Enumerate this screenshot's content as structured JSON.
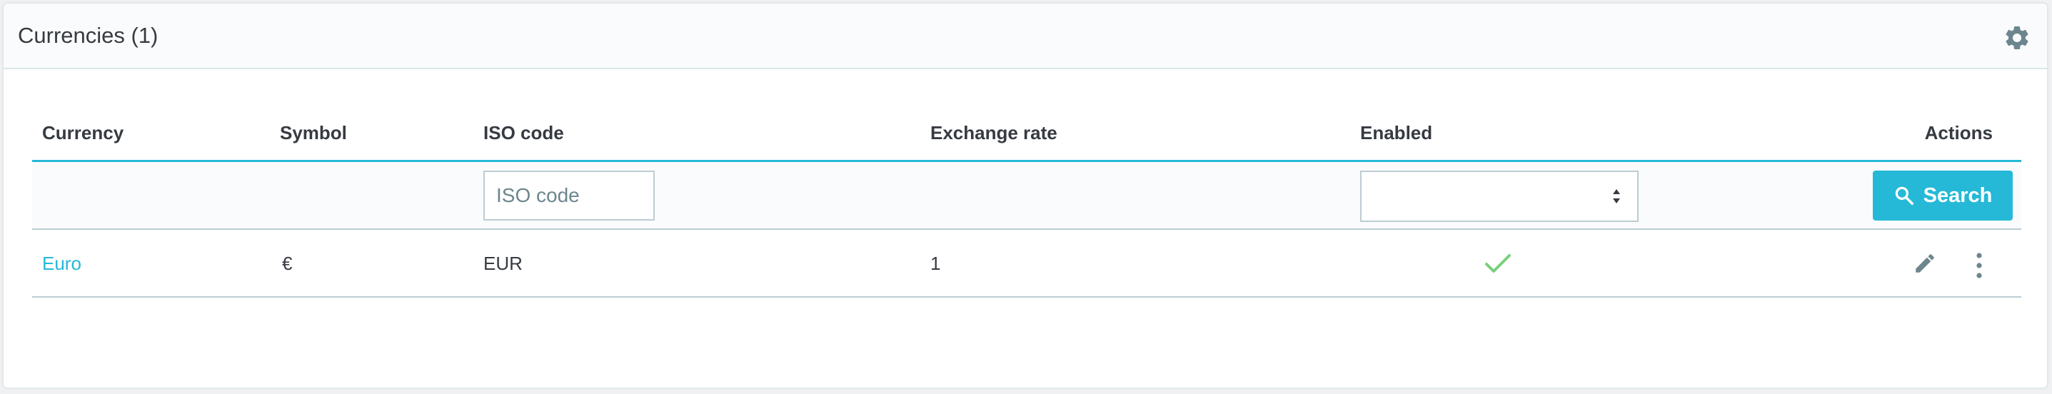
{
  "panel": {
    "title": "Currencies (1)",
    "settings_icon": "gear-icon"
  },
  "table": {
    "columns": [
      "Currency",
      "Symbol",
      "ISO code",
      "Exchange rate",
      "Enabled",
      "Actions"
    ],
    "filters": {
      "iso_code_placeholder": "ISO code",
      "iso_code_value": "",
      "enabled_value": "",
      "search_label": "Search"
    },
    "rows": [
      {
        "currency": "Euro",
        "symbol": "€",
        "iso_code": "EUR",
        "exchange_rate": "1",
        "enabled": true
      }
    ]
  },
  "colors": {
    "accent": "#25b9d7",
    "enabled_check": "#78d07d",
    "text": "#363a41",
    "icon": "#6c868e"
  }
}
